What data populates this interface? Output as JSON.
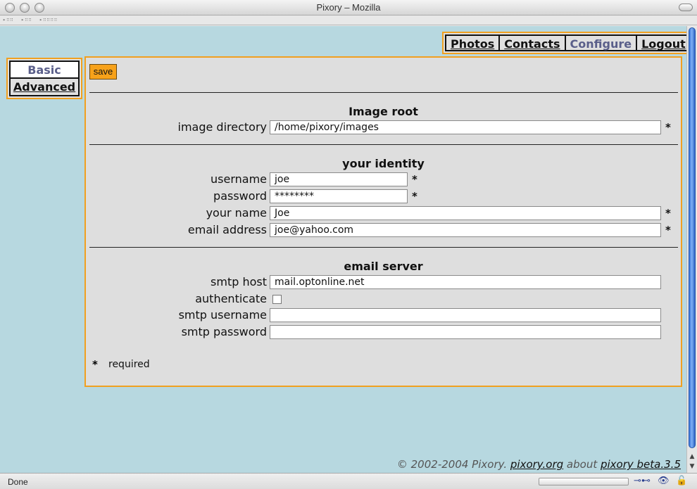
{
  "window": {
    "title": "Pixory – Mozilla"
  },
  "status": {
    "text": "Done"
  },
  "nav": {
    "tabs": [
      {
        "label": "Photos",
        "active": false
      },
      {
        "label": "Contacts",
        "active": false
      },
      {
        "label": "Configure",
        "active": true
      },
      {
        "label": "Logout",
        "active": false
      }
    ]
  },
  "sidebar": {
    "tabs": [
      {
        "label": "Basic",
        "active": true
      },
      {
        "label": "Advanced",
        "active": false
      }
    ]
  },
  "form": {
    "save_label": "save",
    "sections": {
      "image_root": {
        "title": "Image root",
        "image_directory": {
          "label": "image directory",
          "value": "/home/pixory/images",
          "required_mark": "*"
        }
      },
      "identity": {
        "title": "your identity",
        "username": {
          "label": "username",
          "value": "joe",
          "required_mark": "*"
        },
        "password": {
          "label": "password",
          "value": "********",
          "required_mark": "*"
        },
        "your_name": {
          "label": "your name",
          "value": "Joe",
          "required_mark": "*"
        },
        "email": {
          "label": "email address",
          "value": "joe@yahoo.com",
          "required_mark": "*"
        }
      },
      "email_server": {
        "title": "email server",
        "smtp_host": {
          "label": "smtp host",
          "value": "mail.optonline.net"
        },
        "authenticate": {
          "label": "authenticate",
          "checked": false
        },
        "smtp_username": {
          "label": "smtp username",
          "value": ""
        },
        "smtp_password": {
          "label": "smtp password",
          "value": ""
        }
      }
    },
    "required_note": {
      "mark": "*",
      "text": "required"
    }
  },
  "footer": {
    "copyright": "© 2002-2004 Pixory.",
    "site_link": "pixory.org",
    "about": "about",
    "version_link": "pixory beta.3.5"
  },
  "colors": {
    "accent_border": "#f0a020",
    "page_bg": "#b7d8e0",
    "panel_bg": "#dedede",
    "active_tab_text": "#5a5f8a"
  }
}
